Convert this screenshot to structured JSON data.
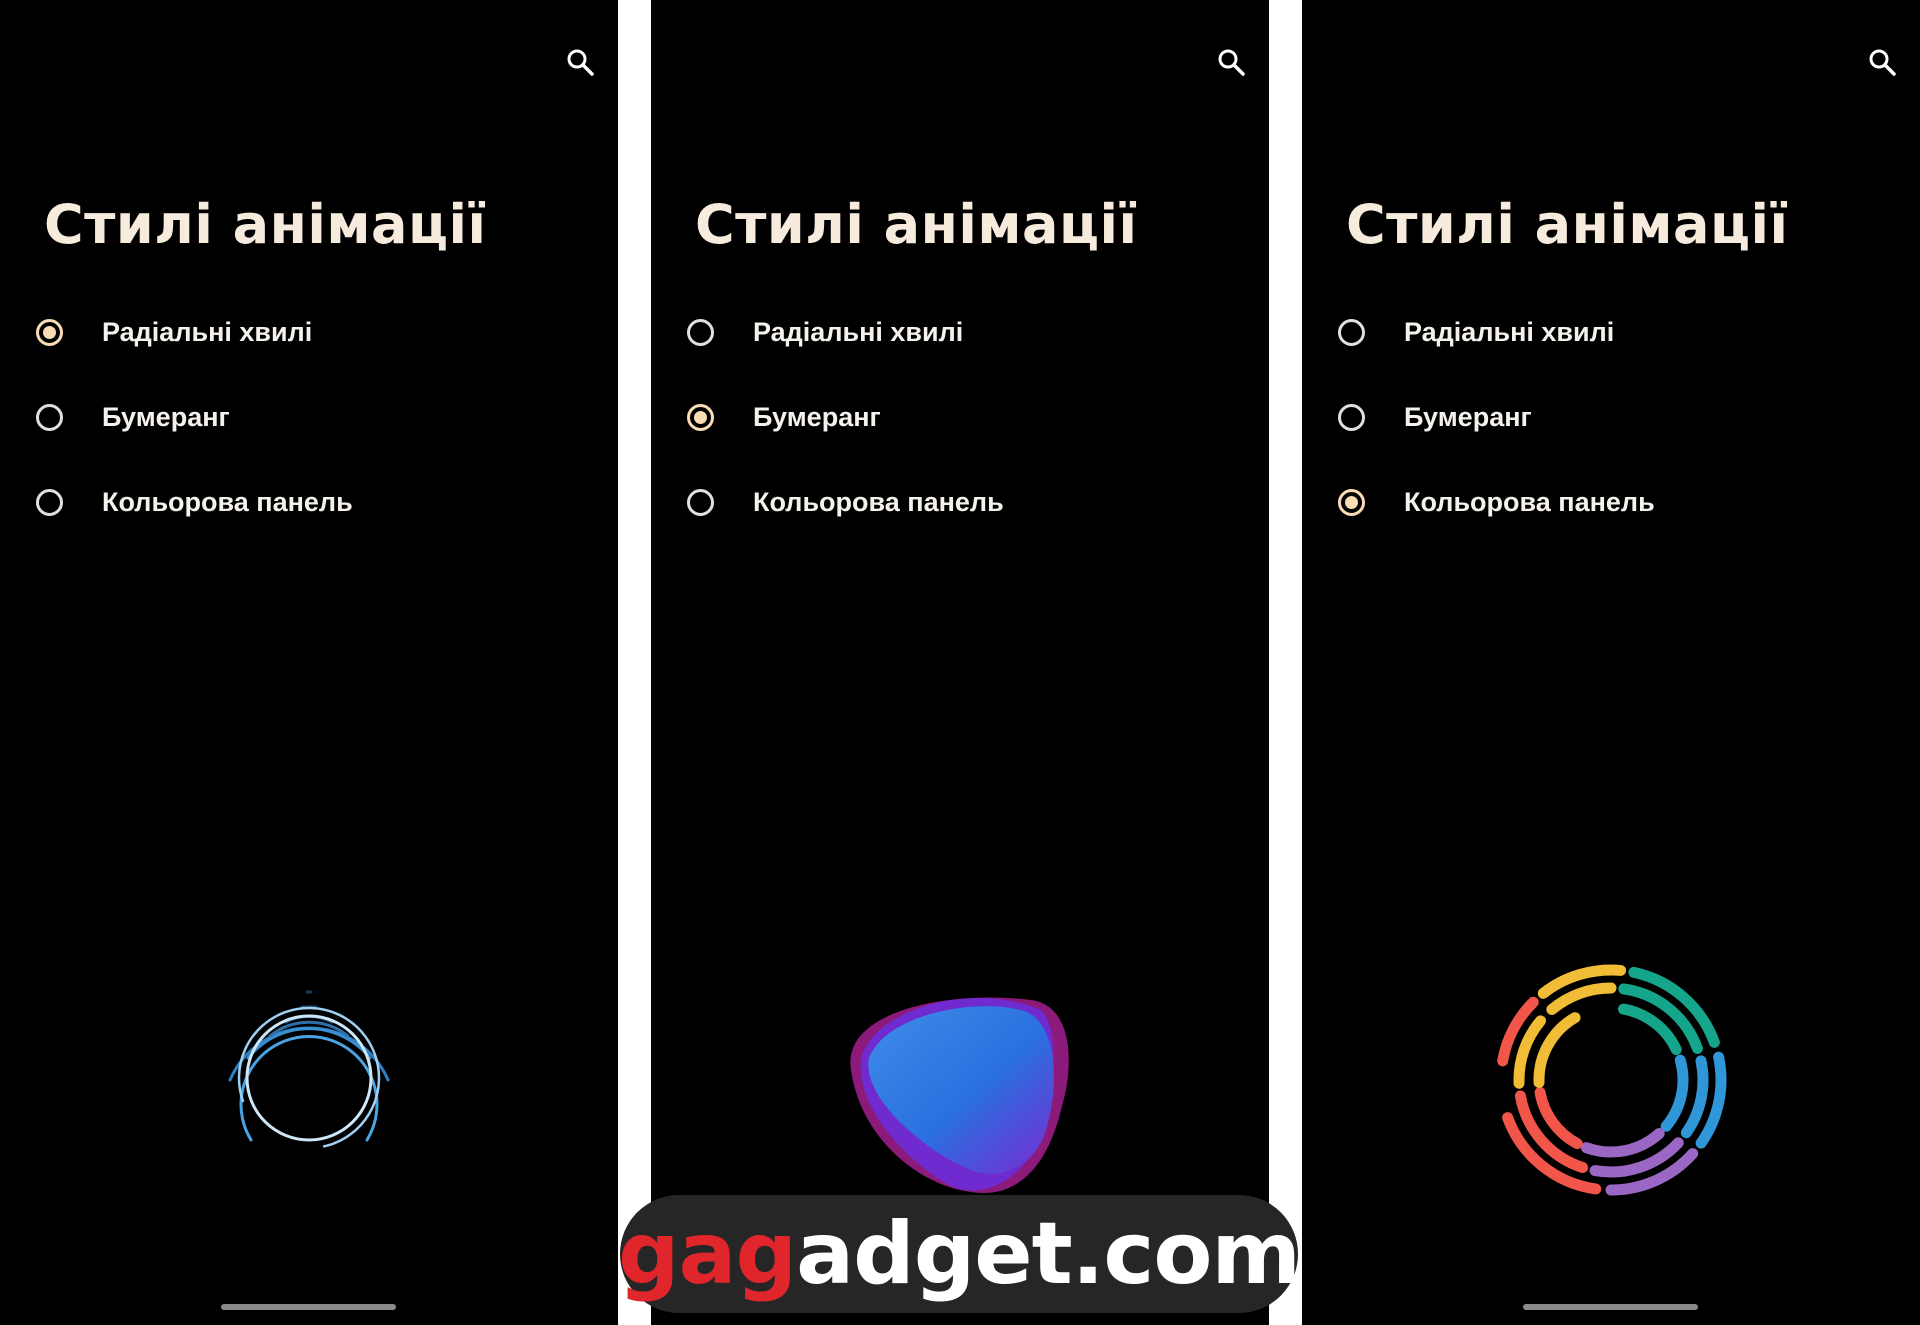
{
  "screens": [
    {
      "title": "Стилі анімації",
      "options": [
        {
          "label": "Радіальні хвилі",
          "selected": true
        },
        {
          "label": "Бумеранг",
          "selected": false
        },
        {
          "label": "Кольорова панель",
          "selected": false
        }
      ]
    },
    {
      "title": "Стилі анімації",
      "options": [
        {
          "label": "Радіальні хвилі",
          "selected": false
        },
        {
          "label": "Бумеранг",
          "selected": true
        },
        {
          "label": "Кольорова панель",
          "selected": false
        }
      ]
    },
    {
      "title": "Стилі анімації",
      "options": [
        {
          "label": "Радіальні хвилі",
          "selected": false
        },
        {
          "label": "Бумеранг",
          "selected": false
        },
        {
          "label": "Кольорова панель",
          "selected": true
        }
      ]
    }
  ],
  "icons": {
    "search": "search-icon",
    "radial_waves": "radial-waves-animation-icon",
    "boomerang": "boomerang-animation-icon",
    "color_bar": "color-bar-animation-icon"
  },
  "watermark": {
    "part1": "ga",
    "part2": "g",
    "part3": "adget.com"
  },
  "colors": {
    "background": "#000000",
    "divider": "#ffffff",
    "title": "#f7ebdd",
    "option_text": "#f5f1ec",
    "radio_accent": "#f9dcb4",
    "radio_unchecked": "#e0e0e0",
    "home_bar": "#8a8a8a",
    "watermark_red": "#e0252b",
    "watermark_white": "#ffffff",
    "ring_red": "#f2564a",
    "ring_yellow": "#f2bd36",
    "ring_green": "#14a58a",
    "ring_blue": "#2f96d8",
    "ring_purple": "#9b67c4",
    "wave_light": "#cde6f8",
    "wave_blue": "#4aa3e2"
  }
}
